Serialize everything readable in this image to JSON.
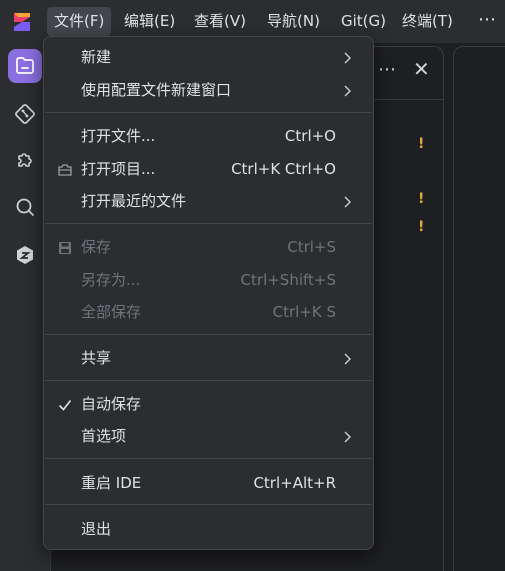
{
  "menubar": {
    "items": [
      {
        "label": "文件(F)"
      },
      {
        "label": "编辑(E)"
      },
      {
        "label": "查看(V)"
      },
      {
        "label": "导航(N)"
      },
      {
        "label": "Git(G)"
      },
      {
        "label": "终端(T)"
      }
    ],
    "more": "⋯"
  },
  "panel": {
    "more": "⋯",
    "close": "✕",
    "warning_mark": "!"
  },
  "file_menu": {
    "new": {
      "label": "新建"
    },
    "new_window_profile": {
      "label": "使用配置文件新建窗口"
    },
    "open_file": {
      "label": "打开文件...",
      "shortcut": "Ctrl+O"
    },
    "open_project": {
      "label": "打开项目...",
      "shortcut": "Ctrl+K Ctrl+O"
    },
    "open_recent": {
      "label": "打开最近的文件"
    },
    "save": {
      "label": "保存",
      "shortcut": "Ctrl+S"
    },
    "save_as": {
      "label": "另存为...",
      "shortcut": "Ctrl+Shift+S"
    },
    "save_all": {
      "label": "全部保存",
      "shortcut": "Ctrl+K S"
    },
    "share": {
      "label": "共享"
    },
    "auto_save": {
      "label": "自动保存",
      "checked": true
    },
    "preferences": {
      "label": "首选项"
    },
    "restart": {
      "label": "重启 IDE",
      "shortcut": "Ctrl+Alt+R"
    },
    "exit": {
      "label": "退出"
    }
  },
  "colors": {
    "accent": "#8a6fe0",
    "warning": "#e0a93c",
    "menu_bg": "#2b2d30"
  }
}
